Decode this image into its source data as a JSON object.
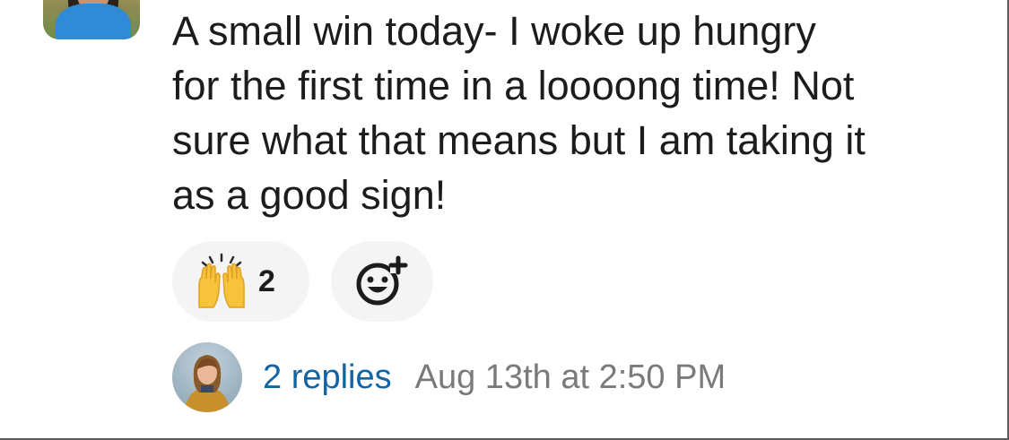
{
  "message": {
    "text": "A small win today- I woke up hungry\nfor the first time in a loooong time! Not\nsure what that means but I am taking it\nas a good sign!"
  },
  "reactions": [
    {
      "emoji": "raising-hands",
      "count": "2"
    }
  ],
  "add_reaction": {
    "icon": "add-emoji-icon"
  },
  "thread": {
    "replies_label": "2 replies",
    "timestamp": "Aug 13th at 2:50 PM"
  },
  "colors": {
    "link": "#1264a3",
    "timestamp": "#7a7a7a",
    "pill_bg": "#f4f4f4",
    "text": "#1d1c1d"
  }
}
